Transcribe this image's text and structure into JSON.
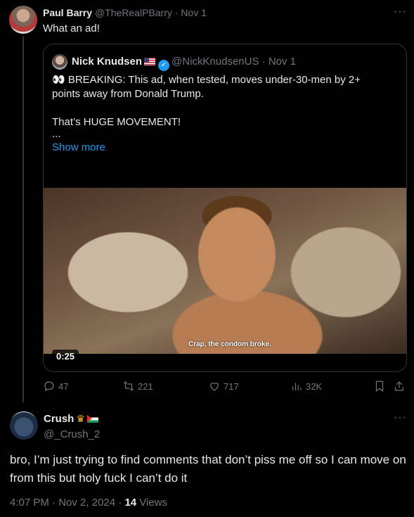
{
  "post": {
    "author_name": "Paul Barry",
    "author_handle": "@TheRealPBarry",
    "date": "Nov 1",
    "text": "What an ad!",
    "more_label": "···",
    "quote": {
      "author_name": "Nick Knudsen",
      "author_handle": "@NickKnudsenUS",
      "date": "Nov 1",
      "line1": "👀 BREAKING: This ad, when tested, moves under-30-men by 2+ points away from Donald Trump.",
      "line2": "That’s HUGE MOVEMENT!",
      "line3": "...",
      "show_more": "Show more",
      "video_subtitle": "Crap, the condom broke.",
      "video_time": "0:25"
    },
    "actions": {
      "replies": "47",
      "reposts": "221",
      "likes": "717",
      "views": "32K"
    }
  },
  "reply": {
    "author_name": "Crush",
    "author_handle": "@_Crush_2",
    "text": "bro, I’m just trying to find comments that don’t piss me off so I can move on from this but holy fuck I can’t do it",
    "time": "4:07 PM",
    "date": "Nov 2, 2024",
    "views_count": "14",
    "views_label": "Views",
    "more_label": "···"
  },
  "colors": {
    "background": "#000000",
    "text": "#e7e9ea",
    "muted": "#71767b",
    "accent": "#1d9bf0",
    "border": "#333639"
  }
}
